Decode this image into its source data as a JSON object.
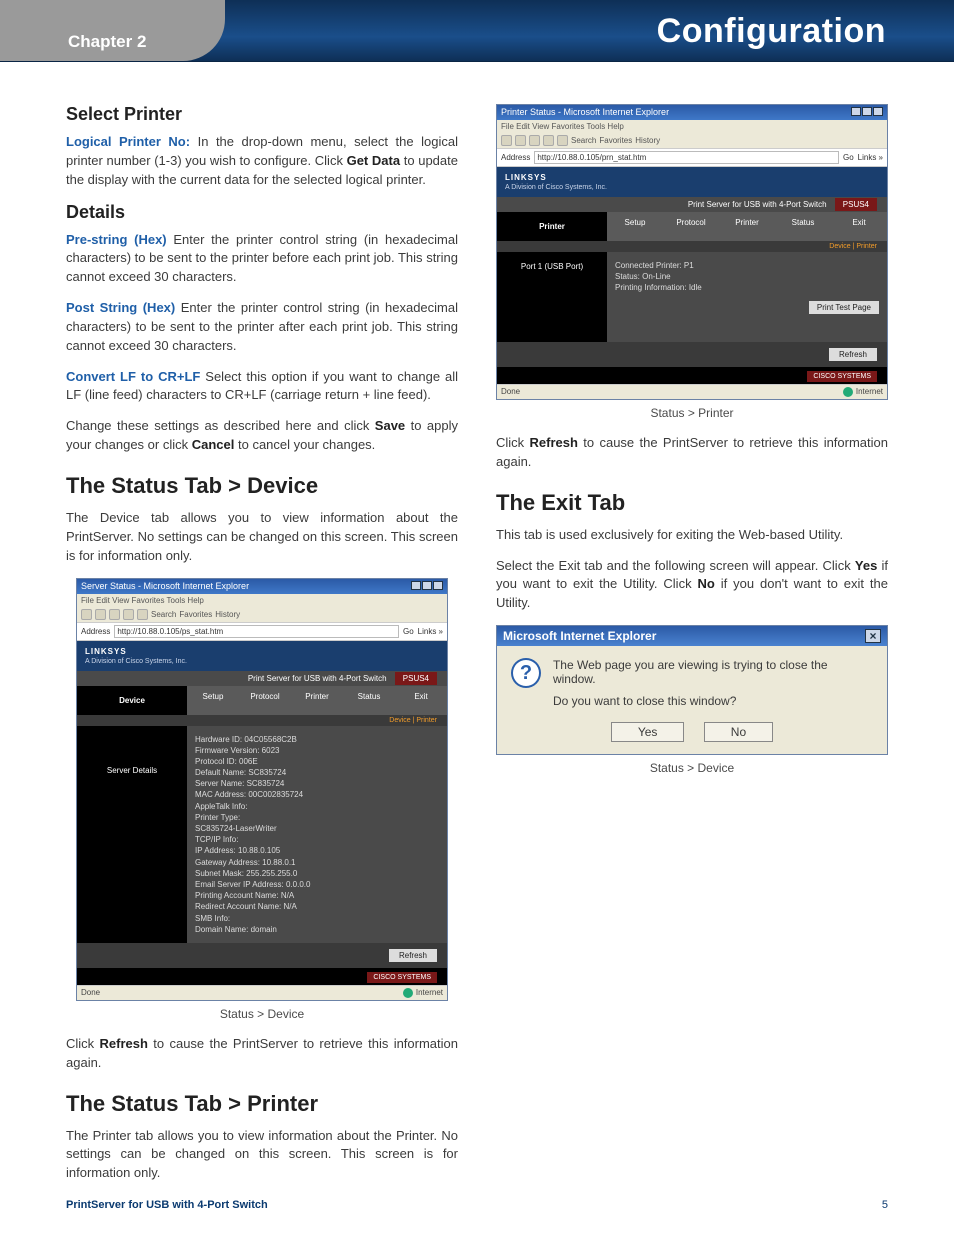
{
  "banner": {
    "chapter": "Chapter 2",
    "title": "Configuration"
  },
  "left": {
    "selectPrinter": {
      "heading": "Select Printer",
      "label": "Logical Printer No:",
      "text": "In the drop-down menu, select the logical printer number (1-3) you wish to configure. Click ",
      "bold": "Get Data",
      "text2": " to update the display with the current data for the selected logical printer."
    },
    "details": {
      "heading": "Details",
      "p1": {
        "label": "Pre-string (Hex)",
        "text": " Enter the printer control string (in hexadecimal characters) to be sent to the printer before each print job. This string cannot exceed 30 characters."
      },
      "p2": {
        "label": "Post String (Hex)",
        "text": " Enter the printer control string (in hexadecimal characters) to be sent to the printer after each print job. This string cannot exceed 30 characters."
      },
      "p3": {
        "label": "Convert LF to CR+LF",
        "text": " Select this option if you want to change all LF (line feed) characters to CR+LF (carriage return + line feed)."
      },
      "p4a": "Change these settings as described here and click ",
      "p4b": "Save",
      "p4c": " to apply your changes or click ",
      "p4d": "Cancel",
      "p4e": " to cancel your changes."
    },
    "statusDevice": {
      "heading": "The Status Tab > Device",
      "p1": "The Device tab allows you to view information about the PrintServer. No settings can be changed on this screen. This screen is for information only."
    },
    "fig1": {
      "winTitle": "Server Status - Microsoft Internet Explorer",
      "menu": "File   Edit   View   Favorites   Tools   Help",
      "addr": "http://10.88.0.105/ps_stat.htm",
      "go": "Go",
      "links": "Links »",
      "brand": "LINKSYS",
      "brandSub": "A Division of Cisco Systems, Inc.",
      "stripText": "Print Server for USB with 4-Port Switch",
      "stripModel": "PSUS4",
      "sideLabel": "Device",
      "tabs": [
        "Setup",
        "Protocol",
        "Printer",
        "Status",
        "Exit"
      ],
      "subbar": "Device  |  Printer",
      "detailsLabel": "Server Details",
      "lines": [
        "Hardware ID: 04C05568C2B",
        "Firmware Version: 6023",
        "Protocol ID: 006E",
        "Default Name: SC835724",
        "Server Name: SC835724",
        "MAC Address: 00C002835724",
        "",
        "AppleTalk Info:",
        "Printer Type:",
        "SC835724-LaserWriter",
        "",
        "TCP/IP Info:",
        "IP Address: 10.88.0.105",
        "Gateway Address: 10.88.0.1",
        "Subnet Mask: 255.255.255.0",
        "Email Server IP Address: 0.0.0.0",
        "Printing Account Name: N/A",
        "Redirect Account Name: N/A",
        "",
        "SMB Info:",
        "Domain Name: domain"
      ],
      "refresh": "Refresh",
      "ciscoLogo": "CISCO SYSTEMS",
      "statusDone": "Done",
      "statusZone": "Internet",
      "caption": "Status > Device"
    },
    "afterFig1a": "Click ",
    "afterFig1b": "Refresh",
    "afterFig1c": " to cause the PrintServer to retrieve this information again.",
    "statusPrinter": {
      "heading": "The Status Tab > Printer",
      "p1": "The Printer tab allows you to view information about the Printer. No settings can be changed on this screen. This screen is for information only."
    }
  },
  "right": {
    "fig2": {
      "winTitle": "Printer Status - Microsoft Internet Explorer",
      "menu": "File   Edit   View   Favorites   Tools   Help",
      "addr": "http://10.88.0.105/prn_stat.htm",
      "go": "Go",
      "links": "Links »",
      "brand": "LINKSYS",
      "brandSub": "A Division of Cisco Systems, Inc.",
      "stripText": "Print Server for USB with 4-Port Switch",
      "stripModel": "PSUS4",
      "sideLabel": "Printer",
      "tabs": [
        "Setup",
        "Protocol",
        "Printer",
        "Status",
        "Exit"
      ],
      "subbar": "Device  |  Printer",
      "portLabel": "Port 1 (USB Port)",
      "rows": [
        "Connected Printer:   P1",
        "Status:              On-Line",
        "Printing Information: Idle"
      ],
      "printTest": "Print Test Page",
      "refresh": "Refresh",
      "ciscoLogo": "CISCO SYSTEMS",
      "statusDone": "Done",
      "statusZone": "Internet",
      "caption": "Status > Printer"
    },
    "afterFig2a": "Click ",
    "afterFig2b": "Refresh",
    "afterFig2c": " to cause the PrintServer to retrieve this information again.",
    "exit": {
      "heading": "The Exit Tab",
      "p1": "This tab is used exclusively for exiting the Web-based Utility.",
      "p2a": "Select the Exit tab and the following screen will appear. Click ",
      "p2b": "Yes",
      "p2c": " if you want to exit the Utility. Click ",
      "p2d": "No",
      "p2e": " if you don't want to exit the Utility."
    },
    "dialog": {
      "title": "Microsoft Internet Explorer",
      "line1": "The Web page you are viewing is trying to close the window.",
      "line2": "Do you want to close this window?",
      "yes": "Yes",
      "no": "No",
      "caption": "Status > Device"
    }
  },
  "footer": {
    "product": "PrintServer for USB with 4-Port Switch",
    "page": "5"
  }
}
